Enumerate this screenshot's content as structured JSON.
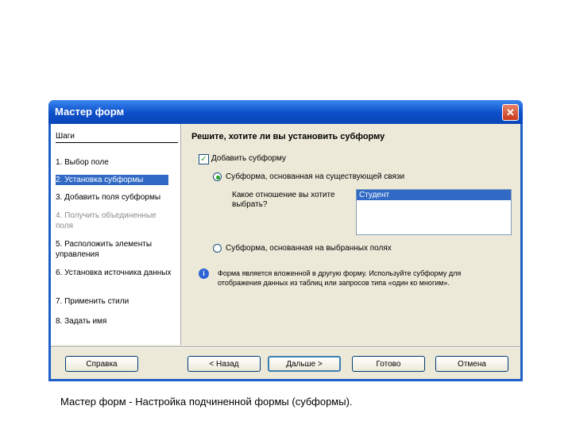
{
  "window": {
    "title": "Мастер форм",
    "close_glyph": "✕"
  },
  "steps": {
    "header": "Шаги",
    "items": [
      {
        "label": "1. Выбор поле",
        "state": "normal"
      },
      {
        "label": "2. Установка субформы",
        "state": "active"
      },
      {
        "label": "3. Добавить поля субформы",
        "state": "normal"
      },
      {
        "label": "4. Получить объединенные поля",
        "state": "disabled"
      },
      {
        "label": "5. Расположить элементы управления",
        "state": "normal"
      },
      {
        "label": "6. Установка источника данных",
        "state": "normal"
      },
      {
        "label": "7. Применить стили",
        "state": "normal"
      },
      {
        "label": "8. Задать имя",
        "state": "normal"
      }
    ]
  },
  "main": {
    "heading": "Решите, хотите ли вы установить субформу",
    "add_subform": {
      "label": "Добавить субформу",
      "checked": true
    },
    "option_existing": {
      "label": "Субформа, основанная на существующей связи",
      "selected": true
    },
    "relation_label": "Какое отношение вы хотите выбрать?",
    "relation_items": [
      "Студент"
    ],
    "option_fields": {
      "label": "Субформа, основанная на выбранных полях",
      "selected": false
    },
    "info_text": "Форма является вложенной в другую форму. Используйте субформу для отображения данных из таблиц или запросов типа «один ко многим»."
  },
  "buttons": {
    "help": "Справка",
    "back": "< Назад",
    "next": "Дальше >",
    "finish": "Готово",
    "cancel": "Отмена"
  },
  "caption": "Мастер форм - Настройка подчиненной формы (субформы).",
  "colors": {
    "titlebar": "#0c4ec9",
    "selection": "#316ac5",
    "dialog_bg": "#ece9d8"
  }
}
